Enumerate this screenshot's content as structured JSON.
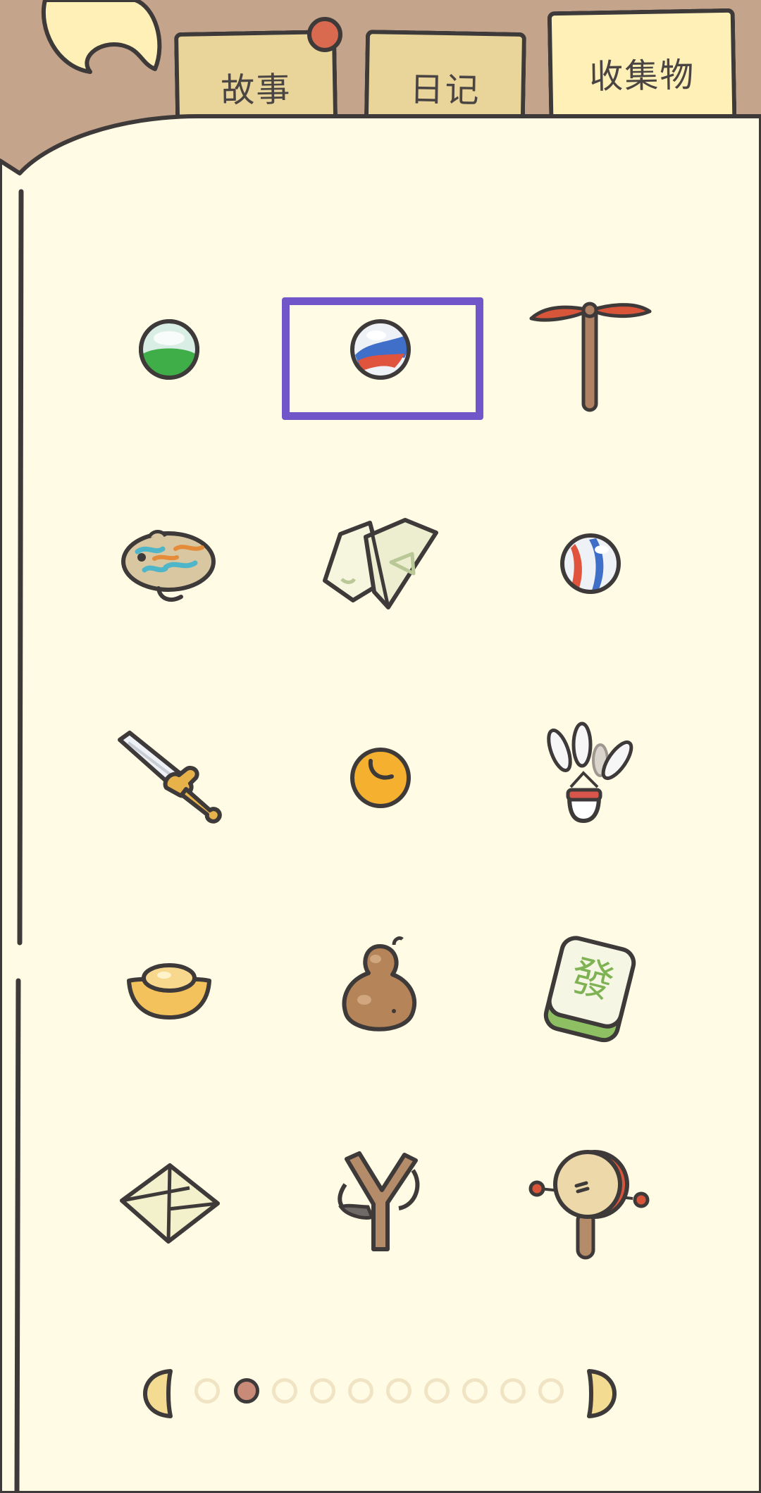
{
  "tabs": [
    {
      "label": "故事",
      "active": false
    },
    {
      "label": "日记",
      "active": false
    },
    {
      "label": "收集物",
      "active": true
    }
  ],
  "colors": {
    "header_bg": "#c4a48b",
    "panel_bg": "#fffbe4",
    "tab_inactive": "#e9d59a",
    "tab_active": "#fff0b8",
    "outline": "#3e3a39",
    "selection": "#7056c8",
    "pin": "#d96a4f",
    "page_dot_active": "#c98a77",
    "page_dot_inactive": "#f0e4c4"
  },
  "items": [
    [
      "green-marble-icon",
      "red-blue-marble-icon",
      "bamboo-dragonfly-icon"
    ],
    [
      "patterned-frog-icon",
      "paper-fortune-teller-icon",
      "tricolor-marble-icon"
    ],
    [
      "toy-sword-icon",
      "orange-candy-icon",
      "shuttlecock-icon"
    ],
    [
      "gold-ingot-icon",
      "gourd-icon",
      "mahjong-tile-icon"
    ],
    [
      "paper-ball-icon",
      "slingshot-icon",
      "rattle-drum-icon"
    ]
  ],
  "selected_item": "red-blue-marble-icon",
  "mahjong_glyph": "發",
  "pagination": {
    "current_page": 2,
    "total_pages": 10
  }
}
